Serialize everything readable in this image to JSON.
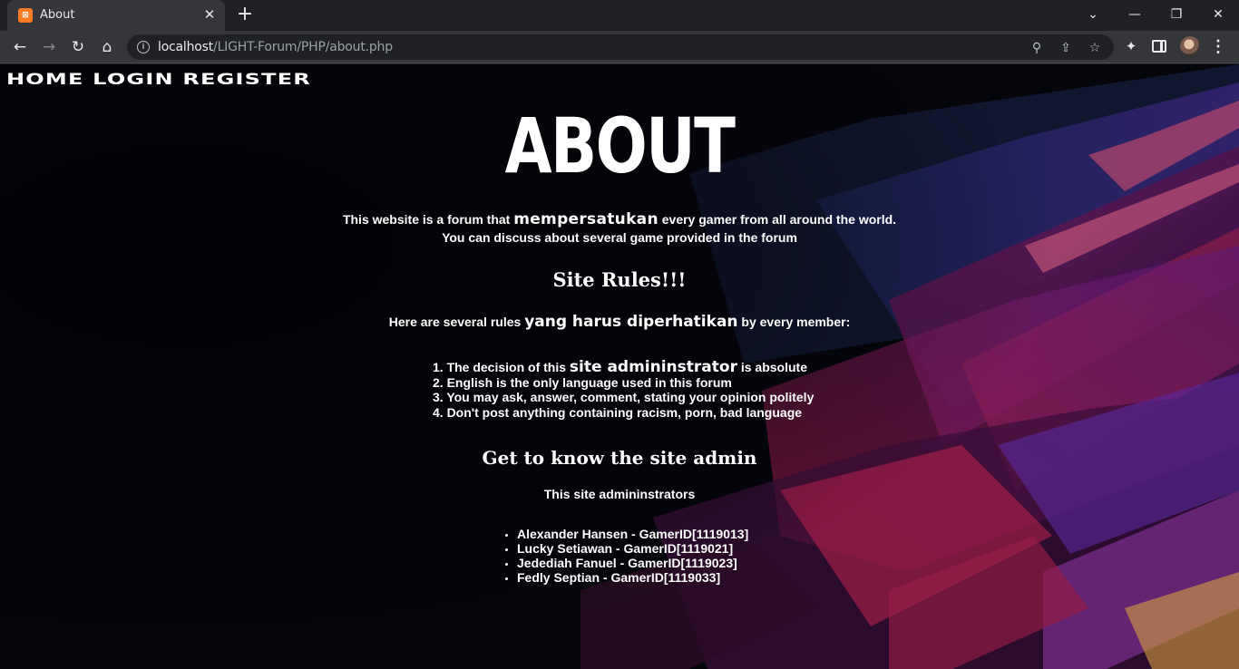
{
  "browser": {
    "tab_title": "About",
    "tab_favicon_text": "⊠",
    "url_host": "localhost",
    "url_path": "/LIGHT-Forum/PHP/about.php"
  },
  "nav": {
    "links": [
      "HOME",
      "LOGIN",
      "REGISTER"
    ]
  },
  "about": {
    "title": "ABOUT",
    "intro_line1_a": "This website is a forum that ",
    "intro_line1_b": "mempersatukan",
    "intro_line1_c": " every gamer from all around the world.",
    "intro_line2": "You can discuss about several game provided in the forum"
  },
  "rules": {
    "title": "Site Rules!!!",
    "intro_a": "Here are several rules ",
    "intro_b": "yang harus diperhatikan",
    "intro_c": " by every member:",
    "items": [
      {
        "a": "1. The decision of this ",
        "b": "site admininstrator",
        "c": " is absolute"
      },
      {
        "a": "2. English is the only language used in this forum",
        "b": "",
        "c": ""
      },
      {
        "a": "3. You may ask, answer, comment, stating your opinion politely",
        "b": "",
        "c": ""
      },
      {
        "a": "4. Don't post anything containing racism, porn, bad language",
        "b": "",
        "c": ""
      }
    ]
  },
  "admins": {
    "title": "Get to know the site admin",
    "intro": "This site admininstrators",
    "list": [
      "Alexander Hansen - GamerID[1119013]",
      "Lucky Setiawan - GamerID[1119021]",
      "Jedediah Fanuel - GamerID[1119023]",
      "Fedly Septian - GamerID[1119033]"
    ]
  }
}
